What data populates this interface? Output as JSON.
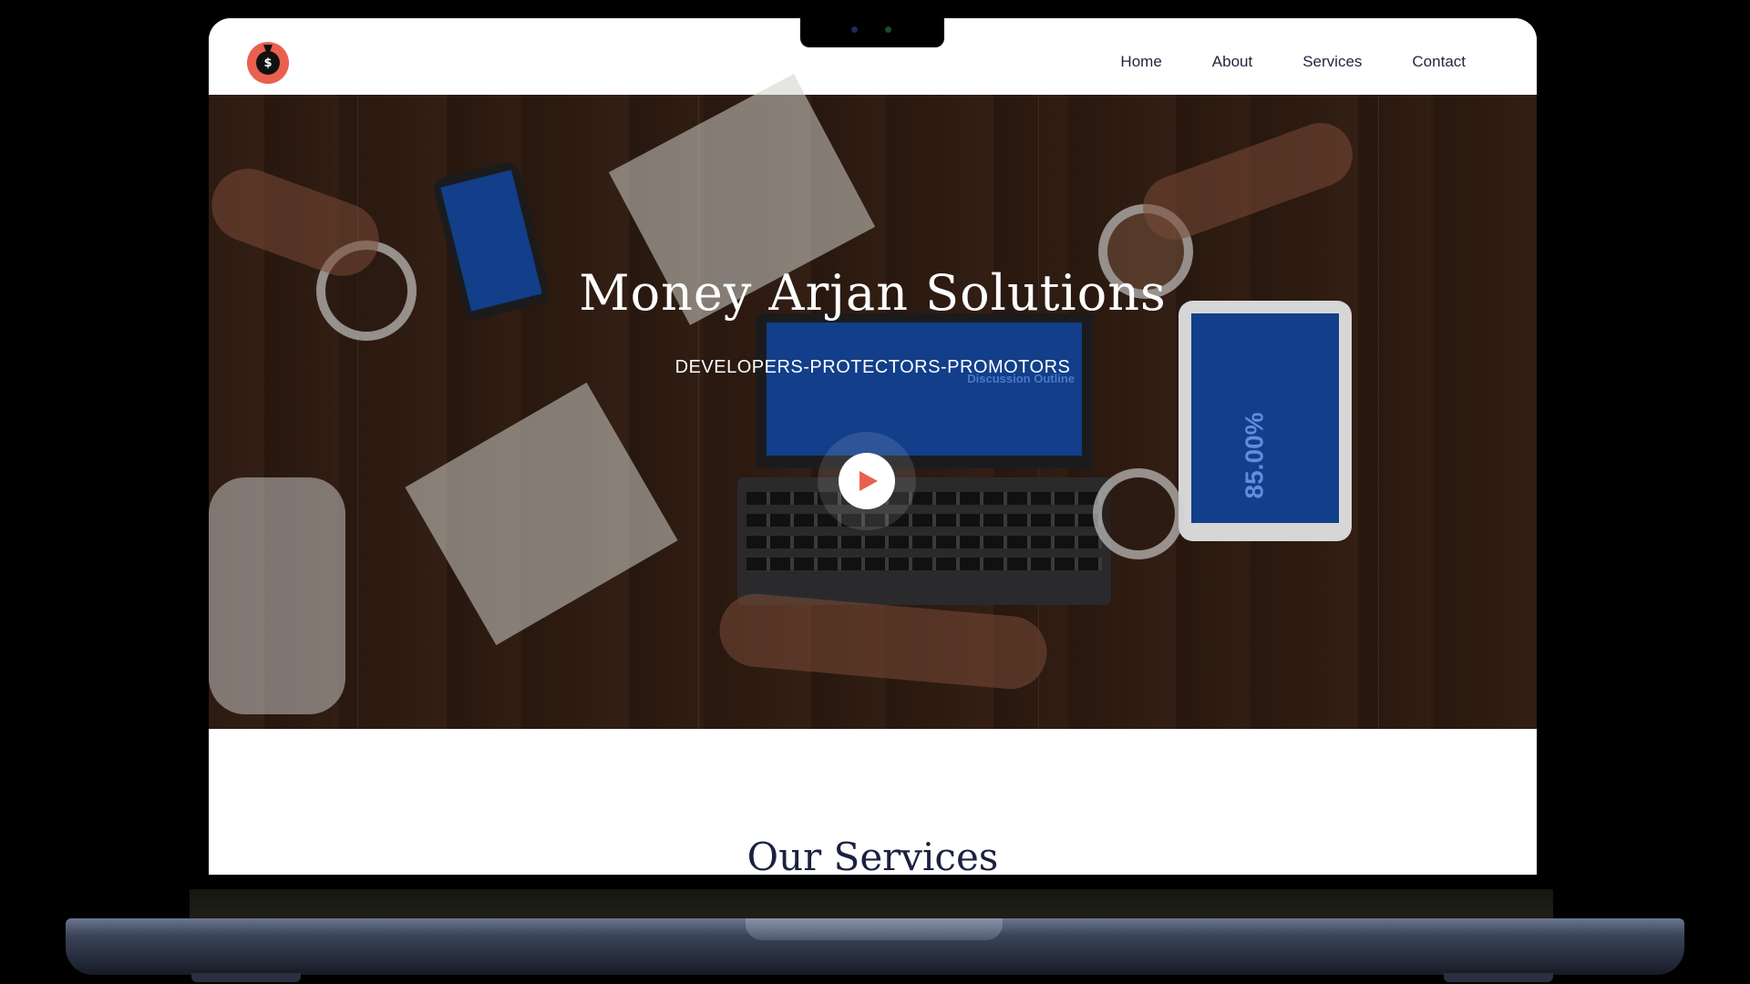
{
  "site": {
    "logo": {
      "icon": "money-bag-icon",
      "symbol": "$"
    },
    "nav": [
      {
        "label": "Home"
      },
      {
        "label": "About"
      },
      {
        "label": "Services"
      },
      {
        "label": "Contact"
      }
    ],
    "accent_color": "#e9604f",
    "heading_color": "#1a2140"
  },
  "hero": {
    "title": "Money Arjan Solutions",
    "subtitle": "DEVELOPERS-PROTECTORS-PROMOTORS",
    "play_icon": "play-icon",
    "laptop_screen_text": "Discussion Outline",
    "tablet_screen_text": "85.00%"
  },
  "services": {
    "title": "Our Services"
  }
}
